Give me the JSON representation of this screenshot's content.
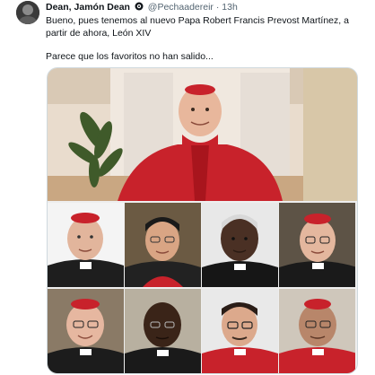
{
  "tweet": {
    "display_name": "Dean, Jamón Dean",
    "handle": "@Pechaadereir",
    "separator": "·",
    "time": "13h",
    "text_line1": "Bueno, pues tenemos al nuevo Papa Robert Francis Prevost Martínez, a partir de ahora, León XIV",
    "text_line2": "Parece que los favoritos no han salido..."
  },
  "icons": {
    "avatar": "profile-avatar",
    "badge": "verified-badge-icon"
  },
  "colors": {
    "text": "#0f1419",
    "secondary_text": "#536471",
    "border": "#cfd9de",
    "cardinal_red": "#c8222b"
  },
  "media": {
    "top_photo": "cardinal-in-red-portrait",
    "grid_portraits": [
      "cardinal-portrait-1",
      "cardinal-portrait-2",
      "cardinal-portrait-3",
      "cardinal-portrait-4",
      "cardinal-portrait-5",
      "cardinal-portrait-6",
      "cardinal-portrait-7",
      "cardinal-portrait-8"
    ]
  }
}
